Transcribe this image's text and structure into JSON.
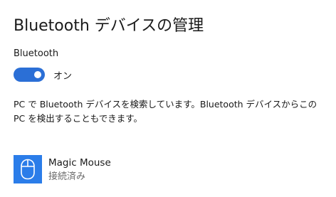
{
  "page": {
    "title": "Bluetooth デバイスの管理"
  },
  "bluetooth": {
    "label": "Bluetooth",
    "toggle_state": "オン",
    "enabled": true
  },
  "description": "PC で Bluetooth デバイスを検索しています。Bluetooth デバイスからこの PC を検出することもできます。",
  "devices": [
    {
      "name": "Magic Mouse",
      "status": "接続済み",
      "icon": "mouse-icon"
    }
  ],
  "colors": {
    "accent": "#2b6fd6",
    "device_tile": "#2b7de9",
    "secondary_text": "#6b6b6b"
  }
}
